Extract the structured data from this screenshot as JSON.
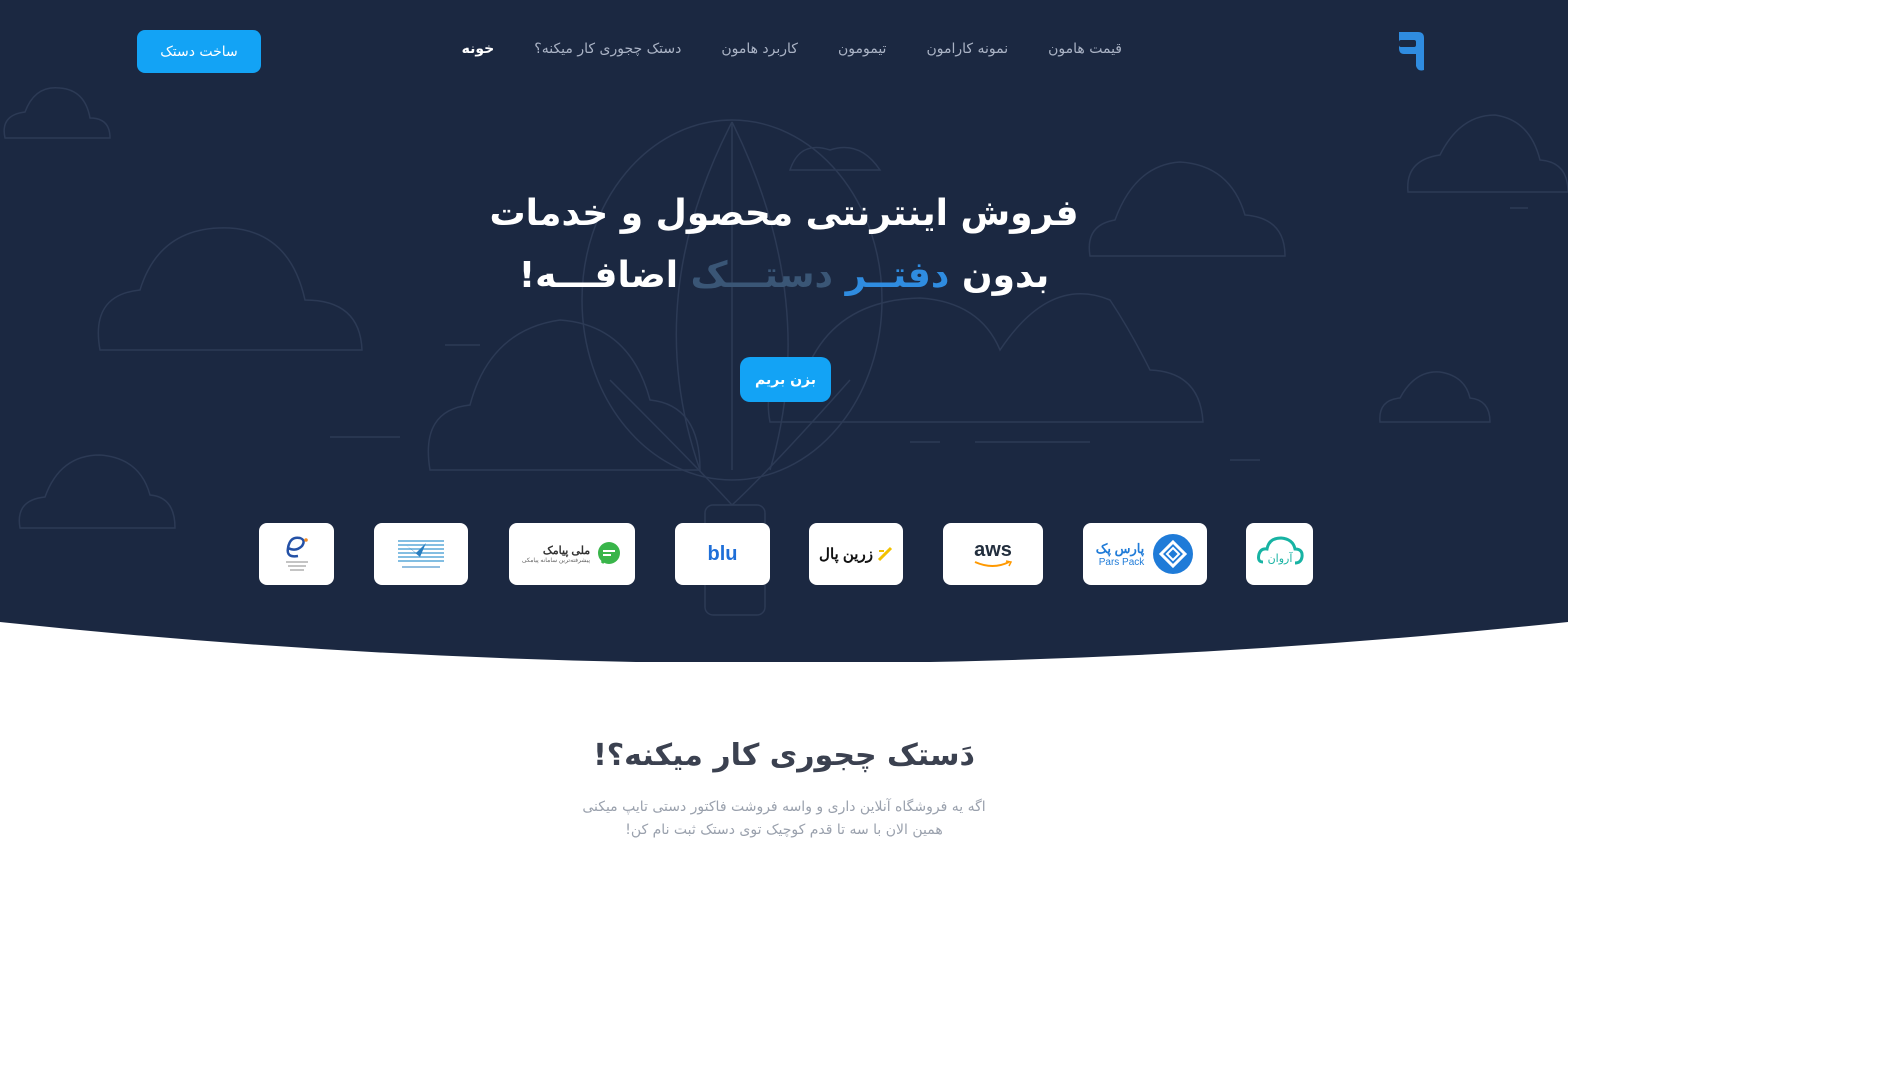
{
  "colors": {
    "hero_bg": "#1b2841",
    "accent": "#13a3f5",
    "highlight_blue": "#2f8ce0",
    "nav_text": "#aab3c5",
    "section_title": "#3b4150",
    "section_text": "#9aa1ad"
  },
  "header": {
    "logo_icon": "dastak-logo",
    "nav": [
      {
        "label": "خونه",
        "active": true
      },
      {
        "label": "دستک چجوری کار میکنه؟",
        "active": false
      },
      {
        "label": "کاربرد هامون",
        "active": false
      },
      {
        "label": "تیمومون",
        "active": false
      },
      {
        "label": "نمونه کارامون",
        "active": false
      },
      {
        "label": "قیمت هامون",
        "active": false
      }
    ],
    "cta_label": "ساخت دستک"
  },
  "hero": {
    "line1": "فروش اینترنتی محصول و خدمات",
    "line2_start": "بدون",
    "line2_blue": "دفتــر",
    "line2_fade": "دستـــک",
    "line2_end": "اضافـــه!",
    "cta_label": "بزن بریم"
  },
  "partners": [
    {
      "name": "arvan-cloud-logo",
      "label": "آروان"
    },
    {
      "name": "parspack-logo",
      "label": "پارس پک",
      "sub": "Pars Pack"
    },
    {
      "name": "aws-logo",
      "label": "aws"
    },
    {
      "name": "zarinpal-logo",
      "label": "زرین پال"
    },
    {
      "name": "blu-bank-logo",
      "label": "blu"
    },
    {
      "name": "melipayamak-logo",
      "label": "ملی پیامک",
      "sub": "پیشرفته‌ترین سامانه پیامکی"
    },
    {
      "name": "sepah-bank-logo",
      "label": ""
    },
    {
      "name": "enamad-logo",
      "label": ""
    }
  ],
  "section": {
    "title": "دَستک چجوری کار میکنه؟!",
    "desc_line1": "اگه یه فروشگاه آنلاین داری و واسه فروشت فاکتور دستی تایپ میکنی",
    "desc_line2": "همین الان با سه تا قدم کوچیک توی دستک ثبت نام کن!"
  }
}
